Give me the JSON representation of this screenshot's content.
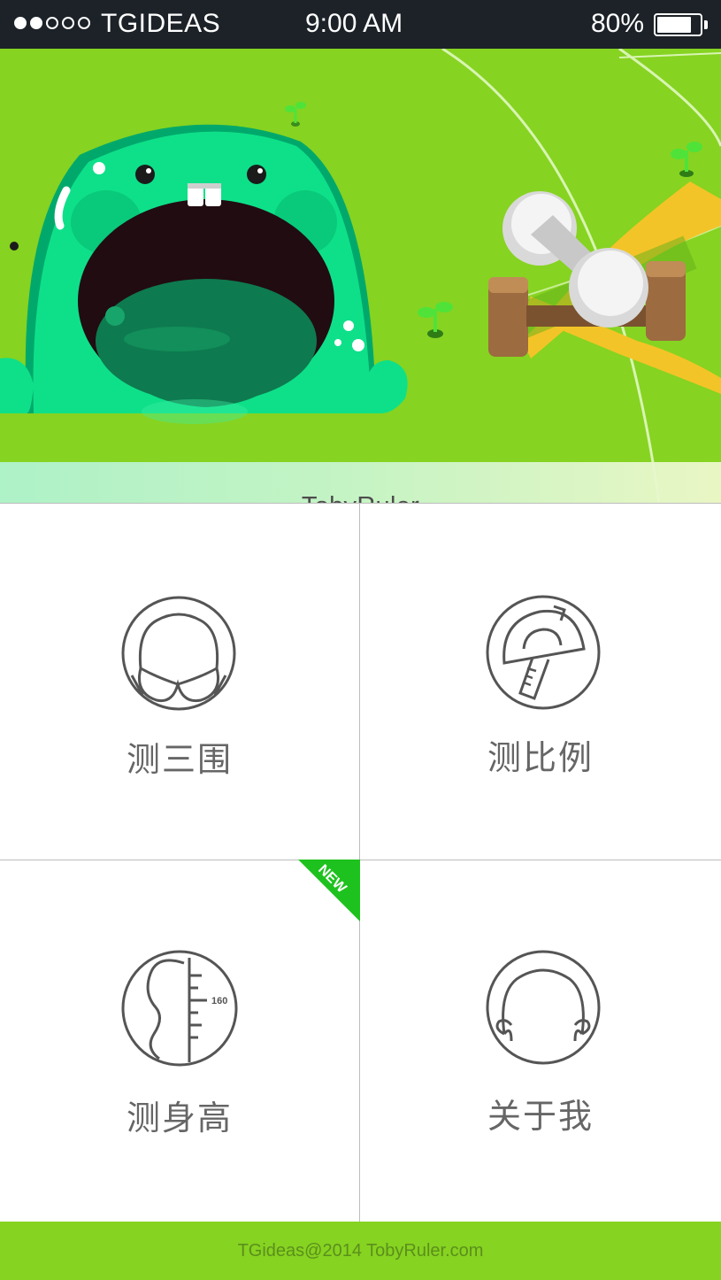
{
  "status_bar": {
    "carrier": "TGIDEAS",
    "time": "9:00 AM",
    "battery_percent": "80%",
    "battery_level": 0.8,
    "signal_bars_filled": 2,
    "signal_bars_total": 5
  },
  "banner": {
    "title": "TobyRuler",
    "background_color": "#86d321"
  },
  "menu": {
    "items": [
      {
        "label": "测三围",
        "icon": "bust-measure-icon"
      },
      {
        "label": "测比例",
        "icon": "protractor-ruler-icon"
      },
      {
        "label": "测身高",
        "icon": "height-measure-icon",
        "badge": "NEW",
        "icon_mark": "160"
      },
      {
        "label": "关于我",
        "icon": "about-me-icon"
      }
    ]
  },
  "footer": {
    "text": "TGideas@2014 TobyRuler.com"
  },
  "colors": {
    "accent_green": "#86d321",
    "badge_green": "#1ec21e",
    "status_bar": "#1c2228"
  }
}
